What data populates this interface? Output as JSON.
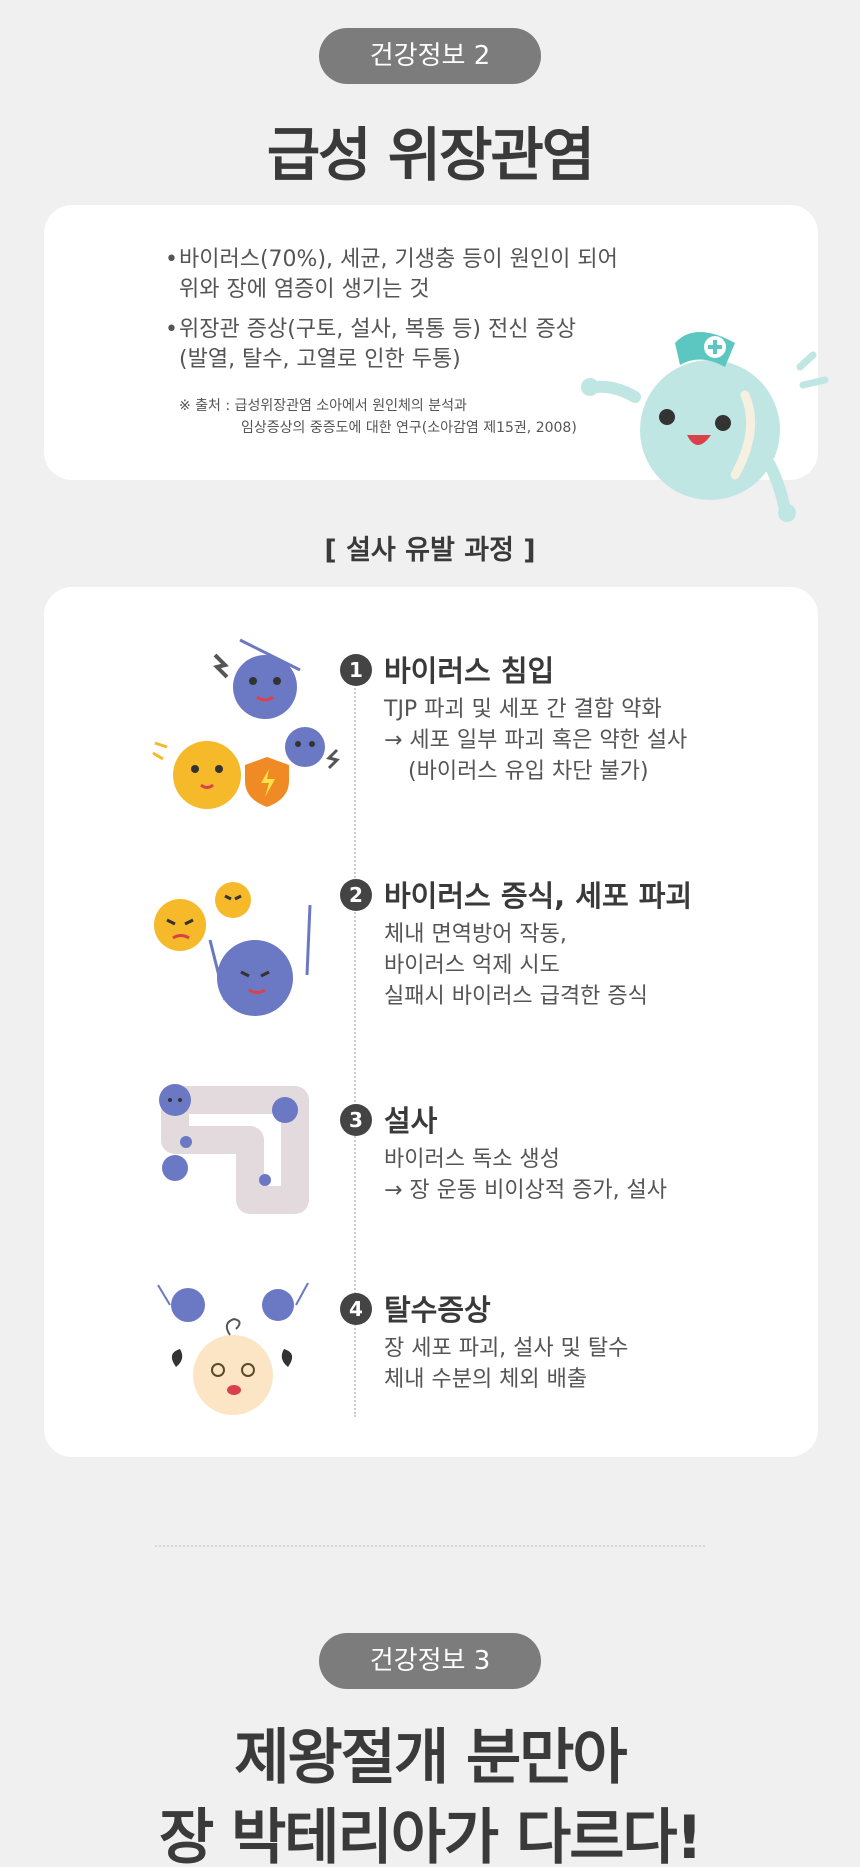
{
  "section1": {
    "pill": "건강정보 2",
    "title": "급성 위장관염",
    "bullets": [
      {
        "line1": "바이러스(70%), 세균, 기생충 등이 원인이 되어",
        "line2": "위와 장에 염증이 생기는 것"
      },
      {
        "line1": "위장관 증상(구토, 설사, 복통 등) 전신 증상",
        "line2": "(발열, 탈수, 고열로 인한 두통)"
      }
    ],
    "source_line1": "※ 출처 : 급성위장관염 소아에서 원인체의 분석과",
    "source_line2": "임상증상의 중증도에 대한 연구(소아감염 제15권, 2008)"
  },
  "process": {
    "label": "[ 설사 유발 과정 ]",
    "steps": [
      {
        "num": "1",
        "title": "바이러스 침입",
        "desc": [
          "TJP 파괴 및 세포 간 결합 약화",
          "→ 세포 일부 파괴 혹은 약한 설사",
          "   (바이러스 유입 차단 불가)"
        ]
      },
      {
        "num": "2",
        "title": "바이러스 증식, 세포 파괴",
        "desc": [
          "체내 면역방어 작동,",
          "바이러스 억제 시도",
          "실패시 바이러스 급격한 증식"
        ]
      },
      {
        "num": "3",
        "title": "설사",
        "desc": [
          "바이러스 독소 생성",
          "→ 장 운동 비이상적 증가, 설사"
        ]
      },
      {
        "num": "4",
        "title": "탈수증상",
        "desc": [
          "장 세포 파괴, 설사 및 탈수",
          "체내 수분의 체외 배출"
        ]
      }
    ]
  },
  "section2": {
    "pill": "건강정보 3",
    "title_line1": "제왕절개 분만아",
    "title_line2": "장 박테리아가 다르다!"
  },
  "colors": {
    "virus": "#6b78c4",
    "cell": "#f5b92a",
    "nurse": "#bfe6e3",
    "pill_bg": "#7c7c7c"
  }
}
